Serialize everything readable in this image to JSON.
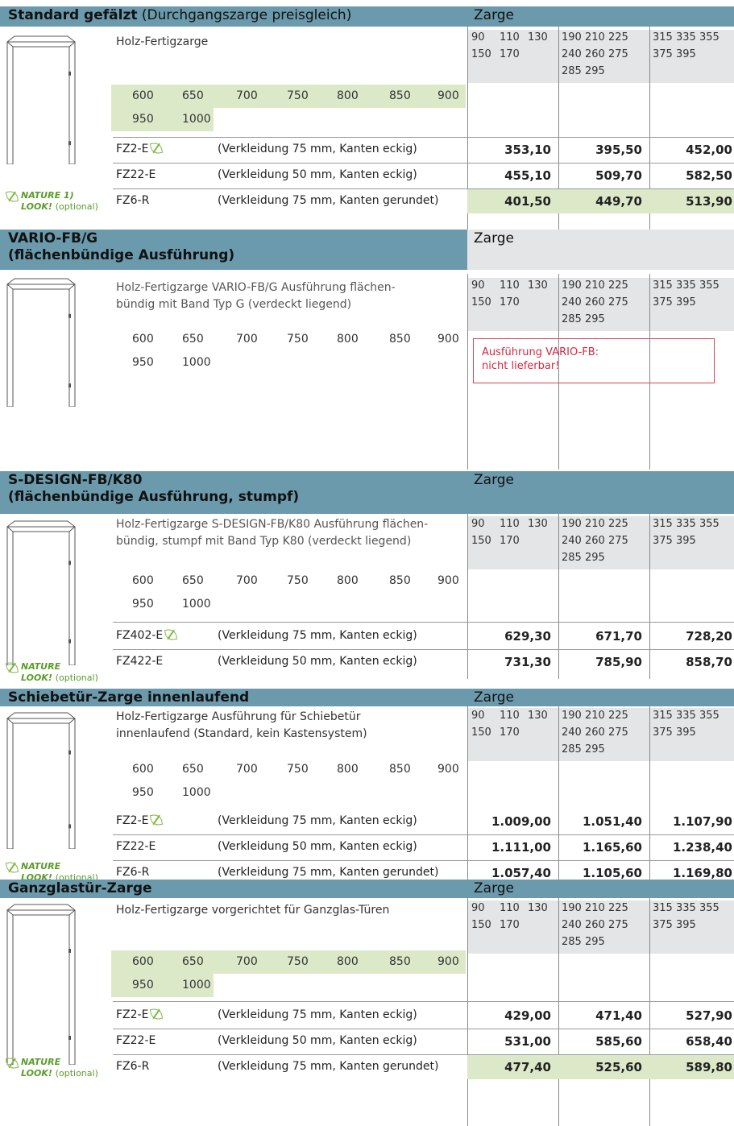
{
  "colors": {
    "header": "#6b9aac",
    "grey": "#e4e5e6",
    "green": "#dce9c9",
    "leaf": "#7fb844",
    "warn": "#d6273f"
  },
  "zarge_label": "Zarge",
  "size_groups": {
    "g1_row1": [
      "90",
      "110",
      "130"
    ],
    "g1_row2": [
      "150",
      "170"
    ],
    "g2_row1": [
      "190",
      "210",
      "225"
    ],
    "g2_row2": [
      "240",
      "260",
      "275"
    ],
    "g2_row3": [
      "285",
      "295"
    ],
    "g3_row1": [
      "315",
      "335",
      "355"
    ],
    "g3_row2": [
      "375",
      "395"
    ]
  },
  "widths_row1": [
    "600",
    "650",
    "700",
    "750",
    "800",
    "850",
    "900"
  ],
  "widths_row2": [
    "950",
    "1000"
  ],
  "nature": {
    "label": "NATURE",
    "footnote": "1)",
    "label2": "LOOK!",
    "optional": "(optional)"
  },
  "sections": [
    {
      "title": "Standard gefälzt",
      "subtitle": "(Durchgangszarge preisgleich)",
      "desc": "Holz-Fertigzarge",
      "products": [
        {
          "code": "FZ2-E",
          "note": "(Verkleidung 75 mm, Kanten eckig)",
          "p1": "353,10",
          "p2": "395,50",
          "p3": "452,00"
        },
        {
          "code": "FZ22-E",
          "note": "(Verkleidung 50 mm, Kanten eckig)",
          "p1": "455,10",
          "p2": "509,70",
          "p3": "582,50"
        },
        {
          "code": "FZ6-R",
          "note": "(Verkleidung 75 mm, Kanten gerundet)",
          "p1": "401,50",
          "p2": "449,70",
          "p3": "513,90"
        }
      ]
    },
    {
      "title": "VARIO-FB/G",
      "title2": "(flächenbündige Ausführung)",
      "desc": "Holz-Fertigzarge VARIO-FB/G Ausführung flächen-bündig mit Band Typ G (verdeckt liegend)",
      "desc_line1": "Holz-Fertigzarge VARIO-FB/G Ausführung flächen-",
      "desc_line2": "bündig mit Band Typ G (verdeckt liegend)",
      "warning_line1": "Ausführung VARIO-FB:",
      "warning_line2": "nicht lieferbar!"
    },
    {
      "title": "S-DESIGN-FB/K80",
      "title2": "(flächenbündige Ausführung, stumpf)",
      "desc_line1": "Holz-Fertigzarge S-DESIGN-FB/K80 Ausführung flächen-",
      "desc_line2": "bündig, stumpf mit Band Typ K80 (verdeckt liegend)",
      "products": [
        {
          "code": "FZ402-E",
          "note": "(Verkleidung 75 mm, Kanten eckig)",
          "p1": "629,30",
          "p2": "671,70",
          "p3": "728,20"
        },
        {
          "code": "FZ422-E",
          "note": "(Verkleidung 50 mm, Kanten eckig)",
          "p1": "731,30",
          "p2": "785,90",
          "p3": "858,70"
        }
      ]
    },
    {
      "title": "Schiebetür-Zarge innenlaufend",
      "desc_line1": "Holz-Fertigzarge Ausführung für Schiebetür",
      "desc_line2": "innenlaufend (Standard, kein Kastensystem)",
      "products": [
        {
          "code": "FZ2-E",
          "note": "(Verkleidung 75 mm, Kanten eckig)",
          "p1": "1.009,00",
          "p2": "1.051,40",
          "p3": "1.107,90"
        },
        {
          "code": "FZ22-E",
          "note": "(Verkleidung 50 mm, Kanten eckig)",
          "p1": "1.111,00",
          "p2": "1.165,60",
          "p3": "1.238,40"
        },
        {
          "code": "FZ6-R",
          "note": "(Verkleidung 75 mm, Kanten gerundet)",
          "p1": "1.057,40",
          "p2": "1.105,60",
          "p3": "1.169,80"
        }
      ]
    },
    {
      "title": "Ganzglastür-Zarge",
      "desc": "Holz-Fertigzarge vorgerichtet für Ganzglas-Türen",
      "products": [
        {
          "code": "FZ2-E",
          "note": "(Verkleidung 75 mm, Kanten eckig)",
          "p1": "429,00",
          "p2": "471,40",
          "p3": "527,90"
        },
        {
          "code": "FZ22-E",
          "note": "(Verkleidung 50 mm, Kanten eckig)",
          "p1": "531,00",
          "p2": "585,60",
          "p3": "658,40"
        },
        {
          "code": "FZ6-R",
          "note": "(Verkleidung 75 mm, Kanten gerundet)",
          "p1": "477,40",
          "p2": "525,60",
          "p3": "589,80"
        }
      ]
    }
  ]
}
